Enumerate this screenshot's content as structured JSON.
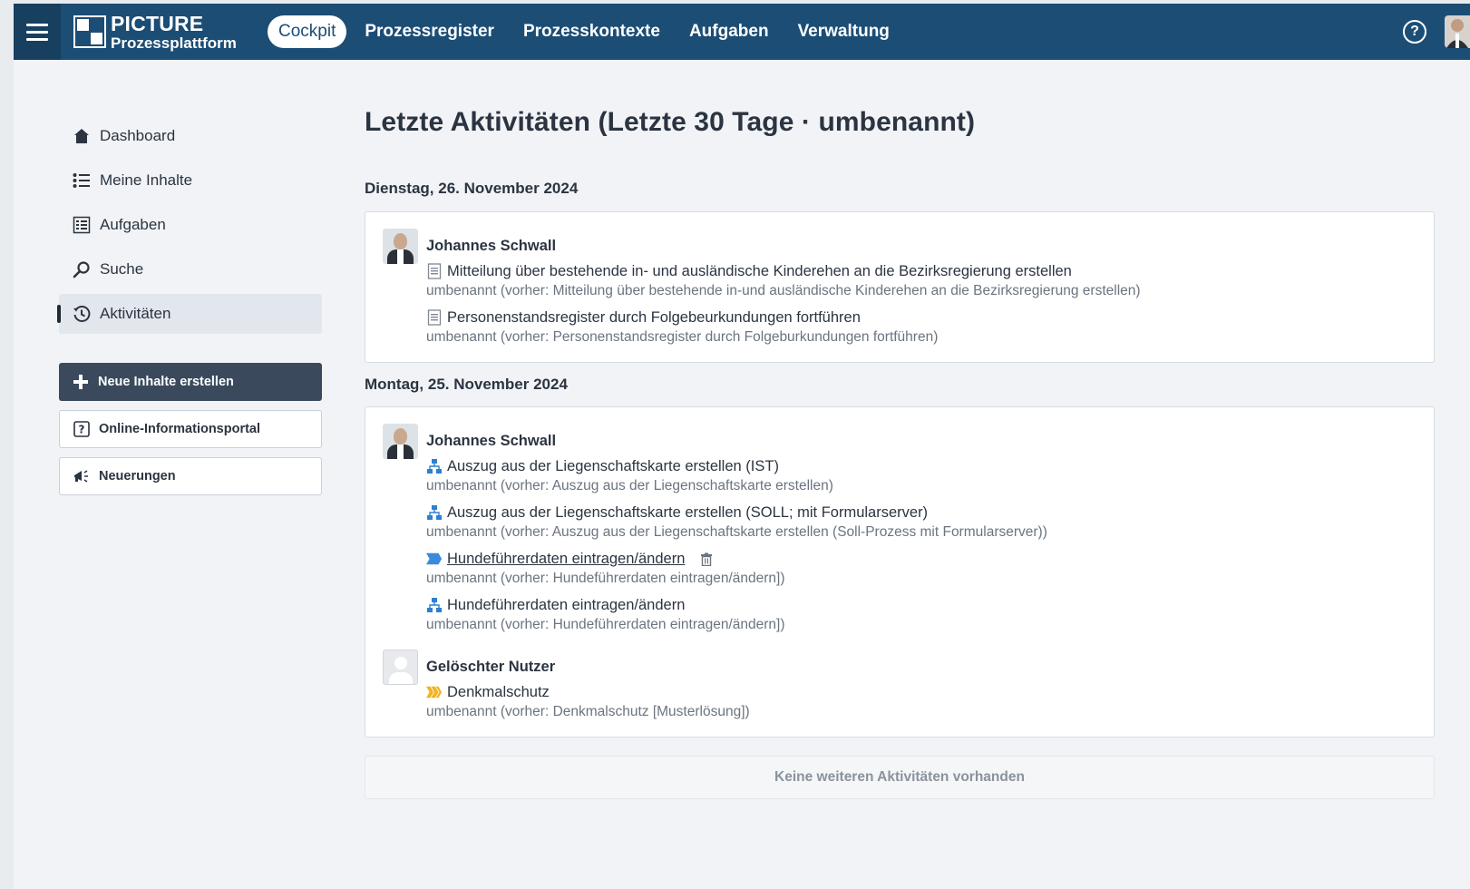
{
  "header": {
    "brand_title": "PICTURE",
    "brand_subtitle": "Prozessplattform",
    "nav": [
      {
        "label": "Cockpit",
        "active": true
      },
      {
        "label": "Prozessregister"
      },
      {
        "label": "Prozesskontexte"
      },
      {
        "label": "Aufgaben"
      },
      {
        "label": "Verwaltung"
      }
    ],
    "help_label": "?",
    "colors": {
      "bar": "#1c4d75",
      "bar_dark": "#173f60"
    }
  },
  "sidebar": {
    "items": [
      {
        "label": "Dashboard",
        "icon": "home-icon"
      },
      {
        "label": "Meine Inhalte",
        "icon": "list-icon"
      },
      {
        "label": "Aufgaben",
        "icon": "tasks-icon"
      },
      {
        "label": "Suche",
        "icon": "search-icon"
      },
      {
        "label": "Aktivitäten",
        "icon": "history-icon",
        "active": true
      }
    ],
    "buttons": {
      "create": "Neue Inhalte erstellen",
      "portal": "Online-Informationsportal",
      "news": "Neuerungen"
    }
  },
  "main": {
    "title": "Letzte Aktivitäten (Letzte 30 Tage · umbenannt)",
    "days": [
      {
        "date": "Dienstag, 26. November 2024",
        "entries": [
          {
            "user": "Johannes Schwall",
            "items": [
              {
                "title": "Mitteilung über bestehende in- und ausländische Kinderehen an die Bezirksregierung erstellen",
                "icon": "document-icon",
                "note": "umbenannt (vorher: Mitteilung über bestehende in-und ausländische Kinderehen an die Bezirksregierung erstellen)"
              },
              {
                "title": "Personenstandsregister durch Folgebeurkundungen fortführen",
                "icon": "document-icon",
                "note": "umbenannt (vorher: Personenstandsregister durch Folgeburkundungen fortführen)"
              }
            ]
          }
        ]
      },
      {
        "date": "Montag, 25. November 2024",
        "entries": [
          {
            "user": "Johannes Schwall",
            "items": [
              {
                "title": "Auszug aus der Liegenschaftskarte erstellen (IST)",
                "icon": "process-model-icon",
                "note": "umbenannt (vorher: Auszug aus der Liegenschaftskarte erstellen)"
              },
              {
                "title": "Auszug aus der Liegenschaftskarte erstellen (SOLL; mit Formularserver)",
                "icon": "process-model-icon",
                "note": "umbenannt (vorher: Auszug aus der Liegenschaftskarte erstellen (Soll-Prozess mit Formularserver))"
              },
              {
                "title": "Hundeführerdaten eintragen/ändern",
                "icon": "process-step-icon",
                "deleted": true,
                "note": "umbenannt (vorher: Hundeführerdaten eintragen/ändern])"
              },
              {
                "title": "Hundeführerdaten eintragen/ändern",
                "icon": "process-model-icon",
                "note": "umbenannt (vorher: Hundeführerdaten eintragen/ändern])"
              }
            ]
          },
          {
            "user": "Gelöschter Nutzer",
            "deleted_user": true,
            "items": [
              {
                "title": "Denkmalschutz",
                "icon": "process-chain-icon",
                "note": "umbenannt (vorher: Denkmalschutz [Musterlösung])"
              }
            ]
          }
        ]
      }
    ],
    "footer": "Keine weiteren Aktivitäten vorhanden"
  }
}
